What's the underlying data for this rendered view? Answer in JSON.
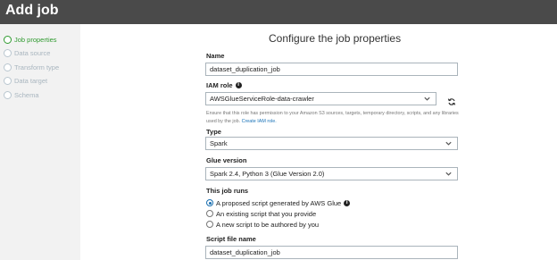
{
  "header": {
    "title": "Add job"
  },
  "sidebar": {
    "steps": [
      {
        "label": "Job properties",
        "active": true
      },
      {
        "label": "Data source",
        "active": false
      },
      {
        "label": "Transform type",
        "active": false
      },
      {
        "label": "Data target",
        "active": false
      },
      {
        "label": "Schema",
        "active": false
      }
    ]
  },
  "form": {
    "title": "Configure the job properties",
    "name": {
      "label": "Name",
      "value": "dataset_duplication_job"
    },
    "iam_role": {
      "label": "IAM role",
      "value": "AWSGlueServiceRole-data-crawler",
      "help": "Ensure that this role has permission to your Amazon S3 sources, targets, temporary directory, scripts, and any libraries used by the job.",
      "help_link": "Create IAM role."
    },
    "type": {
      "label": "Type",
      "value": "Spark"
    },
    "glue_version": {
      "label": "Glue version",
      "value": "Spark 2.4, Python 3 (Glue Version 2.0)"
    },
    "job_runs": {
      "label": "This job runs",
      "options": [
        {
          "label": "A proposed script generated by AWS Glue",
          "selected": true
        },
        {
          "label": "An existing script that you provide",
          "selected": false
        },
        {
          "label": "A new script to be authored by you",
          "selected": false
        }
      ]
    },
    "script_file_name": {
      "label": "Script file name",
      "value": "dataset_duplication_job"
    }
  },
  "icons": {
    "info": "info-icon",
    "chevron": "chevron-down-icon",
    "refresh": "refresh-icon",
    "step_circle": "step-circle-icon",
    "radio": "radio-button"
  },
  "colors": {
    "header_bg": "#4a4a4a",
    "sidebar_bg": "#f2f2f2",
    "active_step": "#2f9a2f",
    "inactive_step": "#a9b6bf",
    "link": "#1a73b8",
    "radio_selected": "#1a6fb0"
  }
}
